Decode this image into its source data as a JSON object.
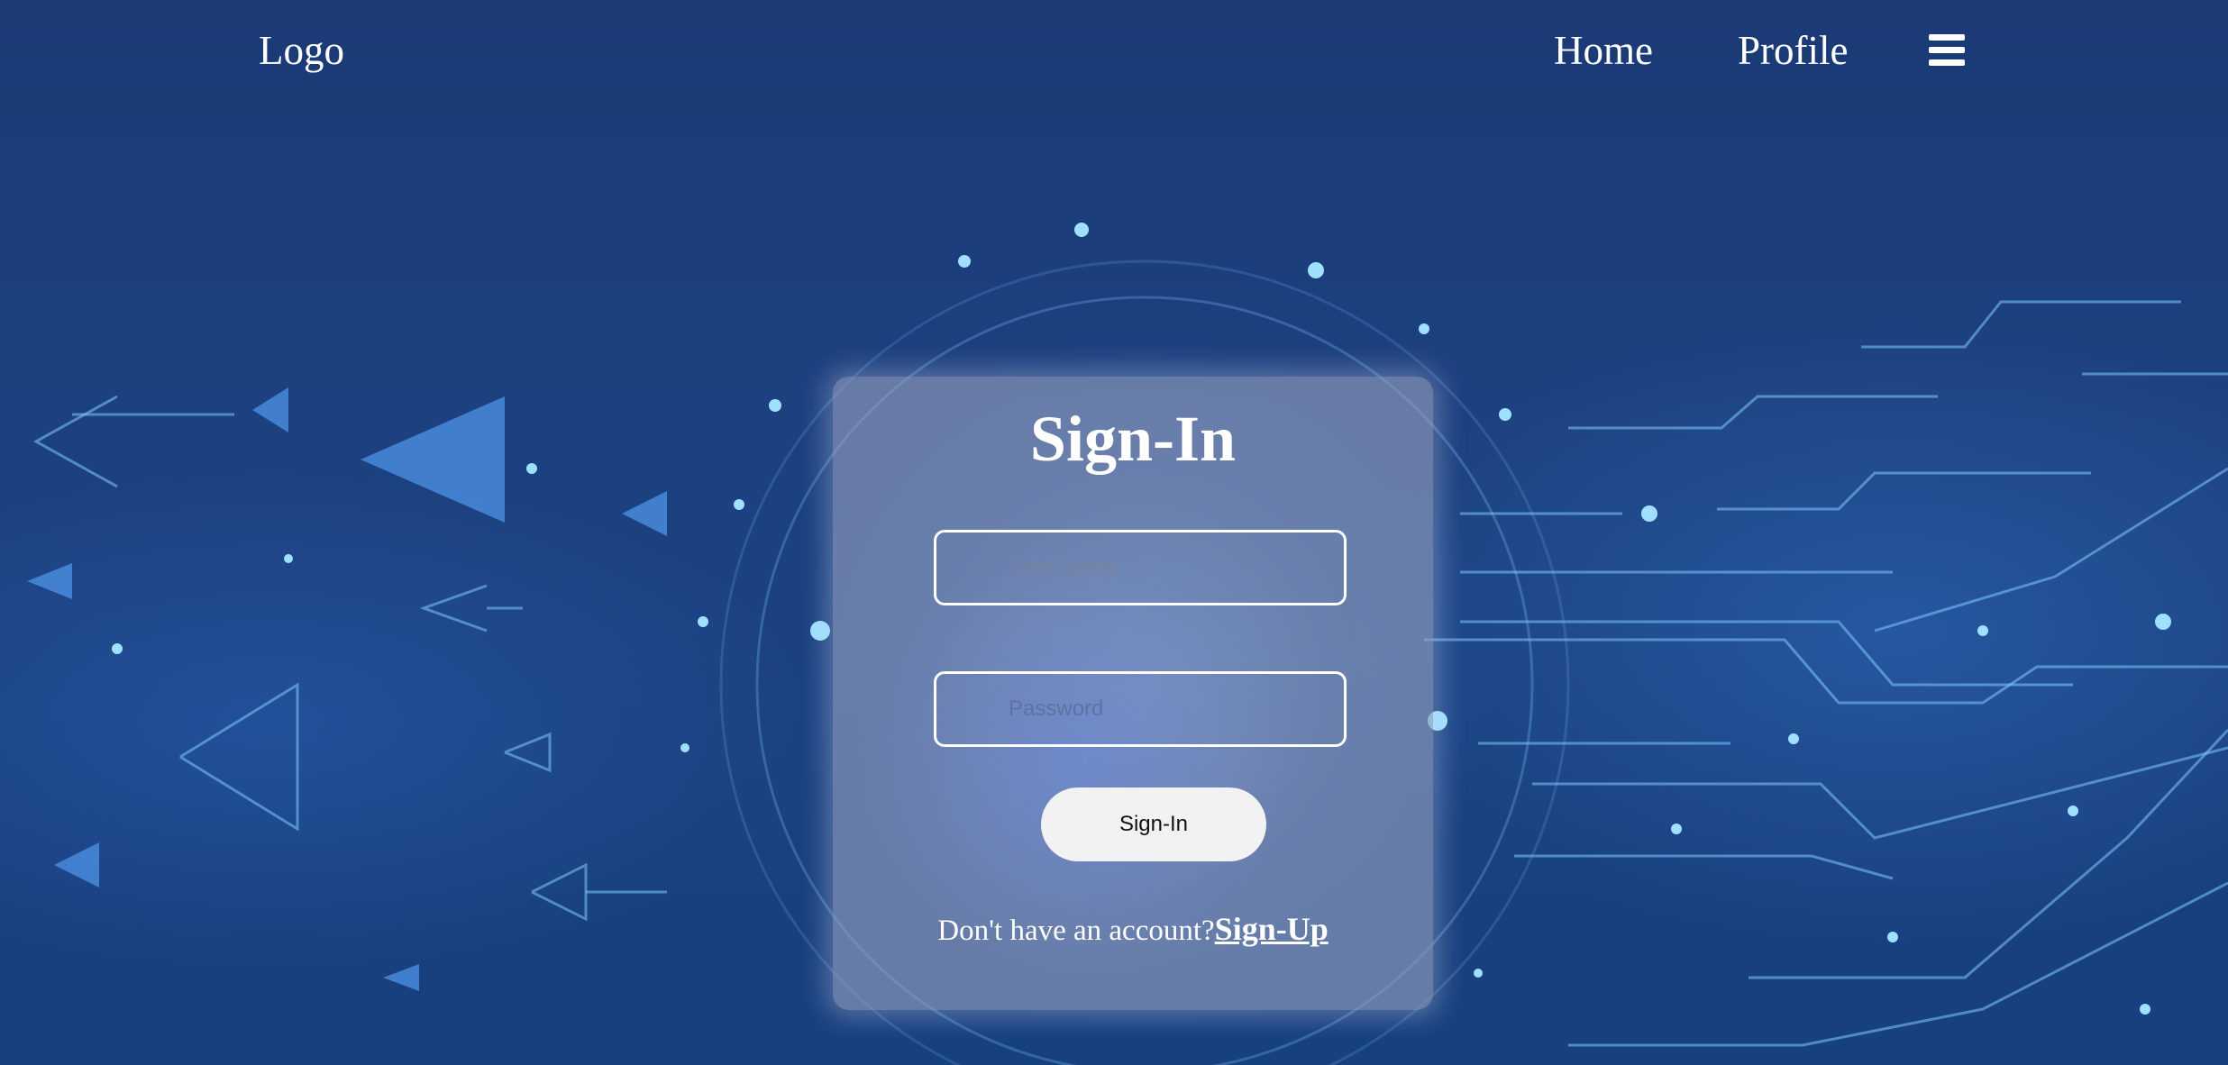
{
  "navbar": {
    "logo": "Logo",
    "links": [
      {
        "label": "Home"
      },
      {
        "label": "Profile"
      }
    ],
    "menu_icon": "hamburger-menu-icon"
  },
  "signin": {
    "title": "Sign-In",
    "username_placeholder": "User Name",
    "username_value": "",
    "password_placeholder": "Password",
    "password_value": "",
    "button_label": "Sign-In",
    "prompt_text": "Don't have an account?",
    "signup_label": "Sign-Up"
  },
  "colors": {
    "background": "#1b3a76",
    "text": "#ffffff",
    "button_bg": "#f2f2f2",
    "accent_glow": "#5aa8ff"
  }
}
